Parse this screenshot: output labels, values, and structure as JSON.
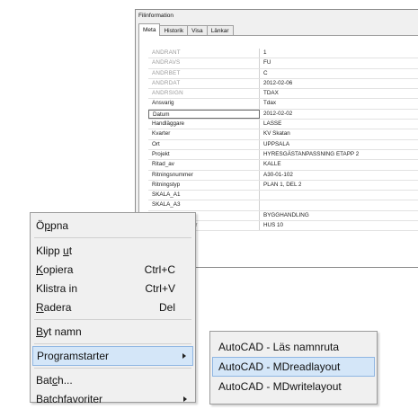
{
  "fileinfo": {
    "title": "Filinformation",
    "tabs": [
      "Meta",
      "Historik",
      "Visa",
      "Länkar"
    ],
    "rows": [
      {
        "key": "ANDRANT",
        "value": "1"
      },
      {
        "key": "ANDRAVS",
        "value": "FU"
      },
      {
        "key": "ANDRBET",
        "value": "C"
      },
      {
        "key": "ANDRDAT",
        "value": "2012-02-06"
      },
      {
        "key": "ANDRSIGN",
        "value": "TDAX"
      },
      {
        "key": "Ansvarig",
        "value": "Tdax"
      },
      {
        "key": "Datum",
        "value": "2012-02-02"
      },
      {
        "key": "Handläggare",
        "value": "LASSE"
      },
      {
        "key": "Kvarter",
        "value": "KV Skatan"
      },
      {
        "key": "Ort",
        "value": "UPPSALA"
      },
      {
        "key": "Projekt",
        "value": "HYRESGÄSTANPASSNING ETAPP 2"
      },
      {
        "key": "Ritad_av",
        "value": "KALLE"
      },
      {
        "key": "Ritningsnummer",
        "value": "A30-01-102"
      },
      {
        "key": "Ritningstyp",
        "value": "PLAN 1, DEL 2"
      },
      {
        "key": "SKALA_A1",
        "value": ""
      },
      {
        "key": "SKALA_A3",
        "value": ""
      },
      {
        "key": "Status",
        "value": "BYGGHANDLING"
      },
      {
        "key": "Uppdragsnummer",
        "value": "HUS 10"
      }
    ]
  },
  "context_menu": {
    "open": {
      "pre": "Ö",
      "u": "p",
      "post": "pna"
    },
    "cut": {
      "pre": "Klipp ",
      "u": "u",
      "post": "t"
    },
    "copy": {
      "pre": "",
      "u": "K",
      "post": "opiera"
    },
    "copy_shortcut": "Ctrl+C",
    "paste": "Klistra in",
    "paste_shortcut": "Ctrl+V",
    "delete": {
      "pre": "",
      "u": "R",
      "post": "adera"
    },
    "delete_shortcut": "Del",
    "rename": {
      "pre": "",
      "u": "B",
      "post": "yt namn"
    },
    "programs": {
      "pre": "Pro",
      "u": "g",
      "post": "ramstarter"
    },
    "batch": {
      "pre": "Bat",
      "u": "c",
      "post": "h..."
    },
    "batch_favorites": "Batchfavoriter"
  },
  "submenu": {
    "items": [
      "AutoCAD - Läs namnruta",
      "AutoCAD - MDreadlayout",
      "AutoCAD - MDwritelayout"
    ]
  },
  "colors": {
    "highlight": "#d4e6f8",
    "highlight_border": "#8fb6e3",
    "menu_bg": "#f0f0f0"
  }
}
